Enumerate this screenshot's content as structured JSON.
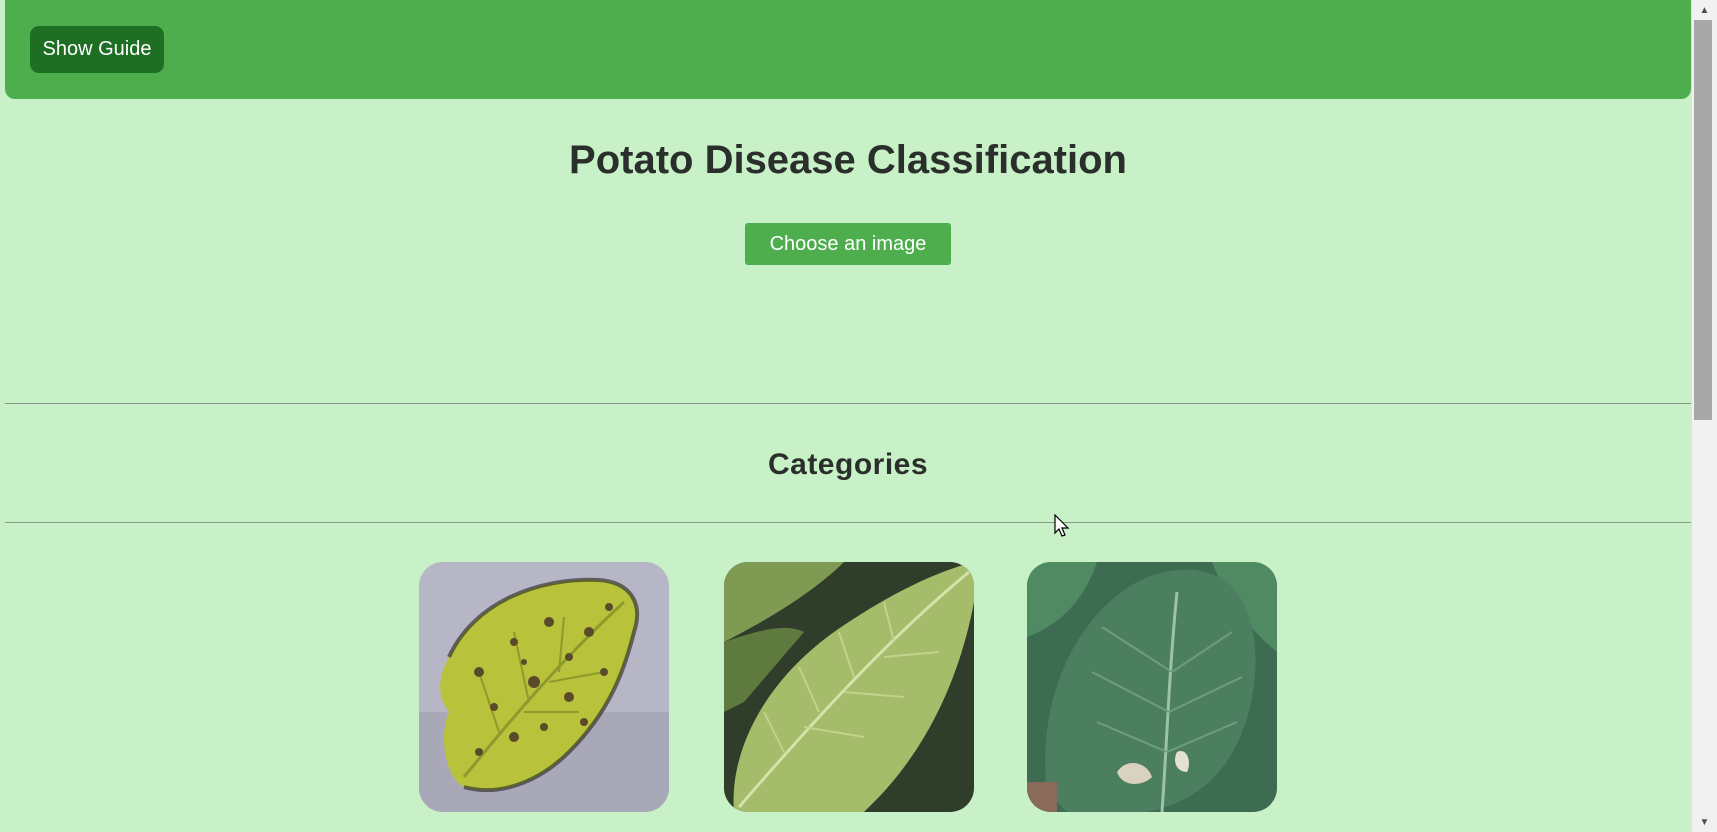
{
  "header": {
    "guide_button": "Show Guide"
  },
  "main": {
    "title": "Potato Disease Classification",
    "choose_button": "Choose an image",
    "categories_title": "Categories"
  },
  "categories": [
    {
      "icon": "early-blight-leaf-image"
    },
    {
      "icon": "late-blight-leaf-image"
    },
    {
      "icon": "healthy-leaf-image"
    }
  ],
  "colors": {
    "background": "#c8f1c8",
    "header": "#4eae4e",
    "guide_button": "#1e6f24",
    "choose_button": "#4eae4e",
    "text": "#2b2f2b"
  }
}
